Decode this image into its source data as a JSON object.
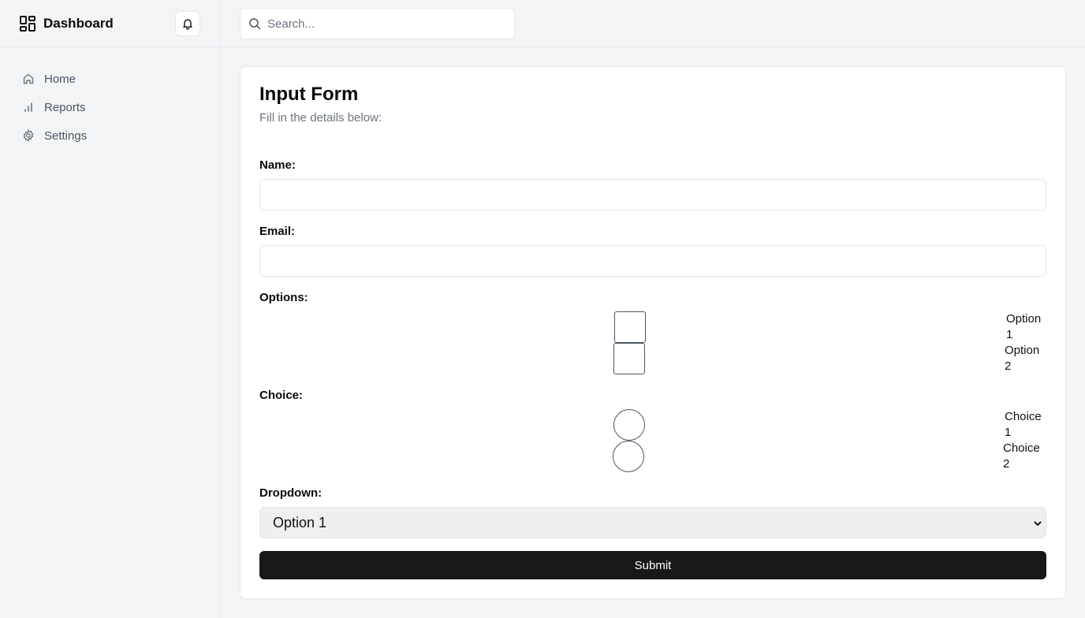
{
  "sidebar": {
    "brand": "Dashboard",
    "nav": [
      {
        "label": "Home",
        "icon": "home-icon"
      },
      {
        "label": "Reports",
        "icon": "bar-chart-icon"
      },
      {
        "label": "Settings",
        "icon": "gear-icon"
      }
    ]
  },
  "topbar": {
    "search_placeholder": "Search..."
  },
  "form": {
    "title": "Input Form",
    "subtitle": "Fill in the details below:",
    "name_label": "Name:",
    "name_value": "",
    "email_label": "Email:",
    "email_value": "",
    "options_label": "Options:",
    "options": [
      {
        "label": "Option 1",
        "checked": false
      },
      {
        "label": "Option 2",
        "checked": false
      }
    ],
    "choice_label": "Choice:",
    "choices": [
      {
        "label": "Choice 1",
        "selected": false
      },
      {
        "label": "Choice 2",
        "selected": false
      }
    ],
    "dropdown_label": "Dropdown:",
    "dropdown_value": "Option 1",
    "submit_label": "Submit"
  },
  "colors": {
    "background": "#f3f4f6",
    "card": "#ffffff",
    "border": "#e5e7eb",
    "muted_text": "#6b7280",
    "primary_button": "#18181b"
  }
}
